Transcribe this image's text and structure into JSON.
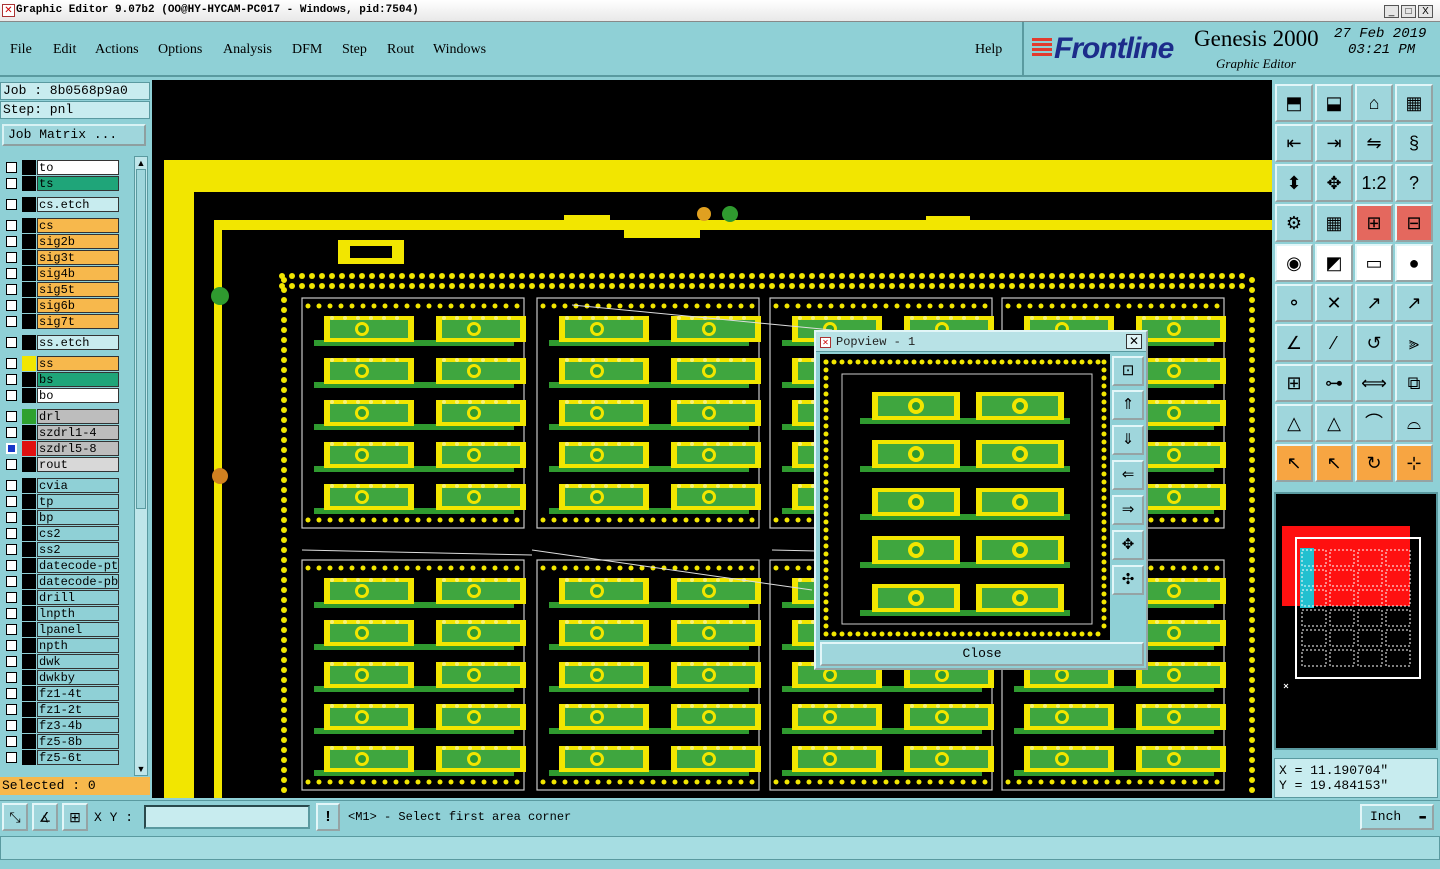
{
  "window": {
    "title": "Graphic Editor 9.07b2 (OO@HY-HYCAM-PC017 - Windows, pid:7504)",
    "controls": [
      "_",
      "□",
      "X"
    ]
  },
  "menu": {
    "items": [
      "File",
      "Edit",
      "Actions",
      "Options",
      "Analysis",
      "DFM",
      "Step",
      "Rout",
      "Windows"
    ],
    "help": "Help"
  },
  "brand": {
    "logo": "Frontline",
    "product": "Genesis 2000",
    "subtitle": "Graphic Editor",
    "date": "27 Feb 2019",
    "time": "03:21 PM"
  },
  "job": {
    "job_line": "Job : 8b0568p9a0",
    "step_line": "Step: pnl",
    "matrix_button": "Job Matrix ..."
  },
  "layers": [
    {
      "name": "to",
      "color": "#ffffff",
      "swatch": "#000000"
    },
    {
      "name": "ts",
      "color": "#1fa579",
      "swatch": "#000000"
    },
    {
      "name": "cs.etch",
      "color": "#c8ecef",
      "swatch": "#000000",
      "gap": true
    },
    {
      "name": "cs",
      "color": "#f7b84c",
      "swatch": "#000000",
      "gap": true
    },
    {
      "name": "sig2b",
      "color": "#f7b84c",
      "swatch": "#000000"
    },
    {
      "name": "sig3t",
      "color": "#f7b84c",
      "swatch": "#000000"
    },
    {
      "name": "sig4b",
      "color": "#f7b84c",
      "swatch": "#000000"
    },
    {
      "name": "sig5t",
      "color": "#f7b84c",
      "swatch": "#000000"
    },
    {
      "name": "sig6b",
      "color": "#f7b84c",
      "swatch": "#000000"
    },
    {
      "name": "sig7t",
      "color": "#f7b84c",
      "swatch": "#000000"
    },
    {
      "name": "ss.etch",
      "color": "#c8ecef",
      "swatch": "#000000",
      "gap": true
    },
    {
      "name": "ss",
      "color": "#f7b84c",
      "swatch": "#f2e600",
      "gap": true
    },
    {
      "name": "bs",
      "color": "#1fa579",
      "swatch": "#000000"
    },
    {
      "name": "bo",
      "color": "#ffffff",
      "swatch": "#000000"
    },
    {
      "name": "drl",
      "color": "#bdbdbd",
      "swatch": "#2fa12f",
      "gap": true
    },
    {
      "name": "szdrl1-4",
      "color": "#bdbdbd",
      "swatch": "#000000"
    },
    {
      "name": "szdrl5-8",
      "color": "#bdbdbd",
      "swatch": "#e01010",
      "active": true
    },
    {
      "name": "rout",
      "color": "#d8d8d8",
      "swatch": "#000000"
    },
    {
      "name": "cvia",
      "color": "#8fd0d6",
      "swatch": "#000000",
      "gap": true
    },
    {
      "name": "tp",
      "color": "#8fd0d6",
      "swatch": "#000000"
    },
    {
      "name": "bp",
      "color": "#8fd0d6",
      "swatch": "#000000"
    },
    {
      "name": "cs2",
      "color": "#8fd0d6",
      "swatch": "#000000"
    },
    {
      "name": "ss2",
      "color": "#8fd0d6",
      "swatch": "#000000"
    },
    {
      "name": "datecode-pte",
      "color": "#8fd0d6",
      "swatch": "#000000"
    },
    {
      "name": "datecode-pbe",
      "color": "#8fd0d6",
      "swatch": "#000000"
    },
    {
      "name": "drill",
      "color": "#8fd0d6",
      "swatch": "#000000"
    },
    {
      "name": "lnpth",
      "color": "#8fd0d6",
      "swatch": "#000000"
    },
    {
      "name": "lpanel",
      "color": "#8fd0d6",
      "swatch": "#000000"
    },
    {
      "name": "npth",
      "color": "#8fd0d6",
      "swatch": "#000000"
    },
    {
      "name": "dwk",
      "color": "#8fd0d6",
      "swatch": "#000000"
    },
    {
      "name": "dwkby",
      "color": "#8fd0d6",
      "swatch": "#000000"
    },
    {
      "name": "fz1-4t",
      "color": "#8fd0d6",
      "swatch": "#000000"
    },
    {
      "name": "fz1-2t",
      "color": "#8fd0d6",
      "swatch": "#000000"
    },
    {
      "name": "fz3-4b",
      "color": "#8fd0d6",
      "swatch": "#000000"
    },
    {
      "name": "fz5-8b",
      "color": "#8fd0d6",
      "swatch": "#000000"
    },
    {
      "name": "fz5-6t",
      "color": "#8fd0d6",
      "swatch": "#000000"
    }
  ],
  "selected": "Selected : 0",
  "popview": {
    "title": "Popview - 1",
    "close_label": "Close"
  },
  "coords": {
    "x": "X = 11.190704\"",
    "y": "Y = 19.484153\""
  },
  "bottom": {
    "xy_label": "X Y :",
    "xy_value": "",
    "message": "<M1> - Select first area corner",
    "units": "Inch"
  },
  "colors": {
    "panel": "#8fd0d6",
    "board_yellow": "#f2e600",
    "board_green": "#2f9a2f",
    "canvas": "#000000"
  }
}
